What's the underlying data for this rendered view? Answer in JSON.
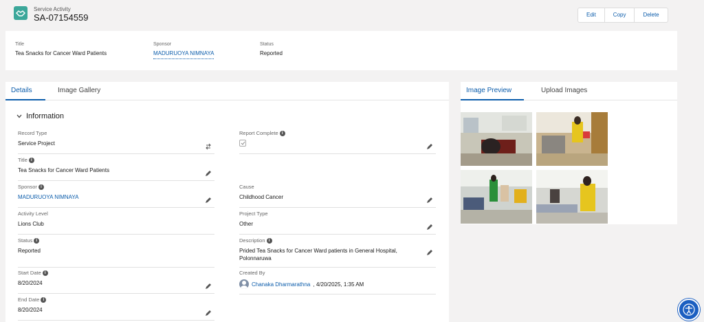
{
  "header": {
    "object_type": "Service Activity",
    "record_name": "SA-07154559",
    "icon": "handshake-icon",
    "actions": [
      "Edit",
      "Copy",
      "Delete"
    ]
  },
  "highlights": {
    "title_label": "Title",
    "title_value": "Tea Snacks for Cancer Ward Patients",
    "sponsor_label": "Sponsor",
    "sponsor_value": "MADURUOYA NIMNAYA",
    "status_label": "Status",
    "status_value": "Reported"
  },
  "main_tabs": [
    "Details",
    "Image Gallery"
  ],
  "section_title": "Information",
  "fields_left": [
    {
      "label": "Record Type",
      "value": "Service Project"
    },
    {
      "label": "Title",
      "value": "Tea Snacks for Cancer Ward Patients"
    },
    {
      "label": "Sponsor",
      "value": "MADURUOYA NIMNAYA"
    },
    {
      "label": "Activity Level",
      "value": "Lions Club"
    },
    {
      "label": "Status",
      "value": "Reported"
    },
    {
      "label": "Start Date",
      "value": "8/20/2024"
    },
    {
      "label": "End Date",
      "value": "8/20/2024"
    }
  ],
  "fields_right": [
    {
      "label": "Report Complete",
      "value": ""
    },
    {
      "label": "Cause",
      "value": "Childhood Cancer"
    },
    {
      "label": "Project Type",
      "value": "Other"
    },
    {
      "label": "Description",
      "value": "Prided Tea Snacks for Cancer Ward patients in General Hospital, Polonnaruwa"
    },
    {
      "label": "Created By",
      "value": "Chanaka Dharmarathna",
      "suffix": ", 4/20/2025, 1:35 AM"
    }
  ],
  "side_tabs": [
    "Image Preview",
    "Upload Images"
  ],
  "colors": {
    "brand": "#0b5cab",
    "icon_bg": "#3ba79a"
  }
}
